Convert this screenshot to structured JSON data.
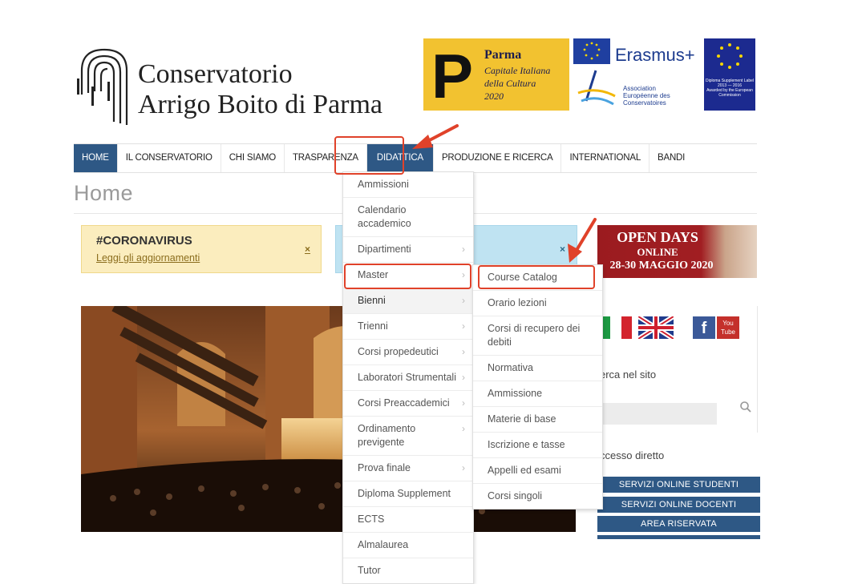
{
  "header": {
    "logo_line1": "Conservatorio",
    "logo_line2": "Arrigo Boito di Parma"
  },
  "banners": {
    "parma": {
      "letter": "P",
      "title": "Parma",
      "line1": "Capitale Italiana",
      "line2": "della Cultura",
      "line3": "2020"
    },
    "erasmus": "Erasmus+",
    "aec": {
      "line1": "Association",
      "line2": "Européenne des",
      "line3": "Conservatoires"
    },
    "dsl": {
      "line1": "Diploma Supplement Label",
      "line2": "2013 — 2016",
      "line3": "Awarded by the European Commission"
    }
  },
  "nav": {
    "items": [
      "HOME",
      "IL CONSERVATORIO",
      "CHI SIAMO",
      "TRASPARENZA",
      "DIDATTICA",
      "PRODUZIONE E RICERCA",
      "INTERNATIONAL",
      "BANDI"
    ]
  },
  "page": {
    "title": "Home"
  },
  "alerts": {
    "covid": {
      "heading": "#CORONAVIRUS",
      "link": "Leggi gli aggiornamenti",
      "close": "×"
    },
    "blue_close": "×"
  },
  "open_days": {
    "line1": "OPEN DAYS",
    "line2": "ONLINE",
    "line3": "28-30 MAGGIO 2020"
  },
  "sidebar": {
    "search_label": "erca nel sito",
    "accesso_label": "ccesso diretto",
    "services": [
      "SERVIZI ONLINE STUDENTI",
      "SERVIZI ONLINE DOCENTI",
      "AREA RISERVATA"
    ],
    "social": {
      "facebook": "f",
      "youtube_top": "You",
      "youtube_bottom": "Tube"
    }
  },
  "didattica_menu": {
    "items": [
      {
        "label": "Ammissioni"
      },
      {
        "label": "Calendario accademico"
      },
      {
        "label": "Dipartimenti",
        "chevron": "›"
      },
      {
        "label": "Master",
        "chevron": "›"
      },
      {
        "label": "Bienni",
        "chevron": "›"
      },
      {
        "label": "Trienni",
        "chevron": "›"
      },
      {
        "label": "Corsi propedeutici",
        "chevron": "›"
      },
      {
        "label": "Laboratori Strumentali",
        "chevron": "›"
      },
      {
        "label": "Corsi Preaccademici",
        "chevron": "›"
      },
      {
        "label": "Ordinamento previgente",
        "chevron": "›"
      },
      {
        "label": "Prova finale",
        "chevron": "›"
      },
      {
        "label": "Diploma Supplement"
      },
      {
        "label": "ECTS"
      },
      {
        "label": "Almalaurea"
      },
      {
        "label": "Tutor"
      }
    ]
  },
  "bienni_submenu": {
    "items": [
      "Course Catalog",
      "Orario lezioni",
      "Corsi di recupero dei debiti",
      "Normativa",
      "Ammissione",
      "Materie di base",
      "Iscrizione e tasse",
      "Appelli ed esami",
      "Corsi singoli"
    ]
  },
  "colors": {
    "nav_active": "#2e5885",
    "annotation": "#e0422a",
    "open_days": "#9b1b1f",
    "parma_yellow": "#f2c230"
  }
}
